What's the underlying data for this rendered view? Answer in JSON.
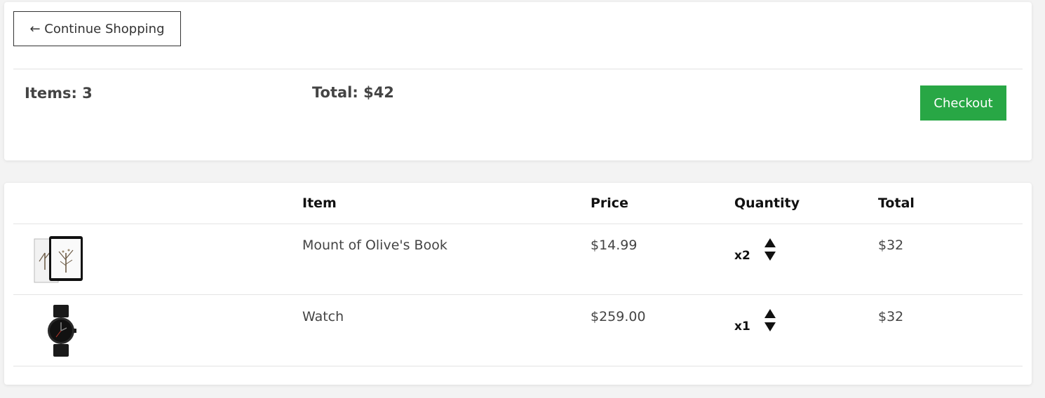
{
  "summary": {
    "continue_label": "← Continue Shopping",
    "items_label": "Items: 3",
    "total_label": "Total: $42",
    "checkout_label": "Checkout",
    "checkout_color": "#28a745"
  },
  "table": {
    "headers": [
      "",
      "Item",
      "Price",
      "Quantity",
      "Total"
    ],
    "rows": [
      {
        "image_icon": "book-tablet-thumbnail",
        "item": "Mount of Olive's Book",
        "price": "$14.99",
        "quantity": "x2",
        "total": "$32"
      },
      {
        "image_icon": "watch-thumbnail",
        "item": "Watch",
        "price": "$259.00",
        "quantity": "x1",
        "total": "$32"
      }
    ]
  }
}
